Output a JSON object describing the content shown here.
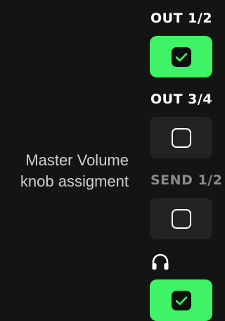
{
  "description": {
    "line1": "Master Volume",
    "line2": "knob assigment"
  },
  "outputs": [
    {
      "label": "OUT 1/2",
      "checked": true,
      "enabled": true
    },
    {
      "label": "OUT 3/4",
      "checked": false,
      "enabled": true
    },
    {
      "label": "SEND 1/2",
      "checked": false,
      "enabled": false
    },
    {
      "icon": "headphones-icon",
      "checked": true,
      "enabled": true
    }
  ],
  "colors": {
    "background": "#141414",
    "accent_on": "#3ff266",
    "tile_off": "#232323",
    "label_dim": "#8a8a8a"
  }
}
